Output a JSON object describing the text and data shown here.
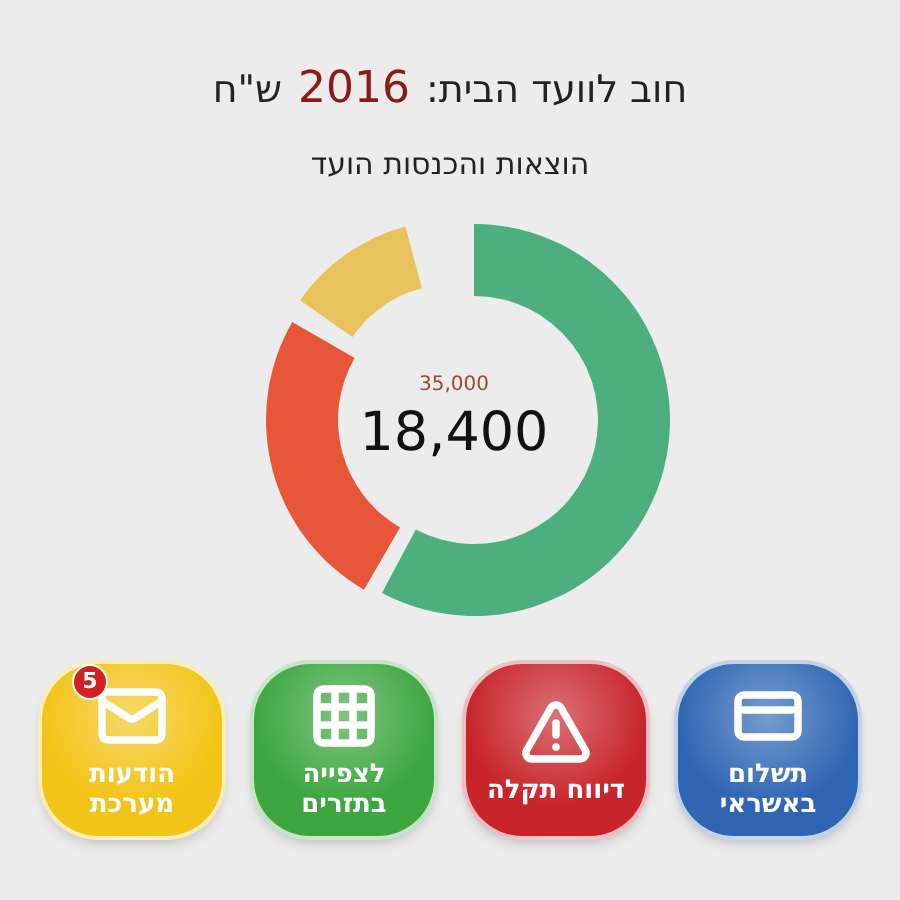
{
  "header": {
    "title_prefix": "חוב לוועד הבית:",
    "amount": "2016",
    "currency": "ש\"ח",
    "subtitle": "הוצאות והכנסות הועד"
  },
  "donut": {
    "top_value": "35,000",
    "main_value": "18,400"
  },
  "buttons": [
    {
      "kind": "payment",
      "label": "תשלום באשראי",
      "color": "#2f66b3"
    },
    {
      "kind": "reports",
      "label": "דיווח תקלה",
      "color": "#c8242b"
    },
    {
      "kind": "table",
      "label": "לצפייה בתזרים",
      "color": "#3da63f"
    },
    {
      "kind": "messages",
      "label": "הודעות מערכת",
      "color": "#f2c417",
      "badge": "5"
    }
  ]
}
